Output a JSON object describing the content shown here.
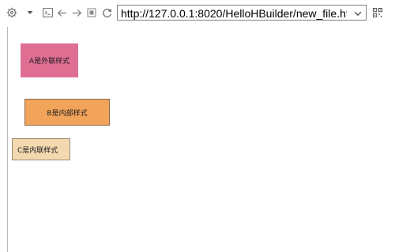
{
  "toolbar": {
    "icons": [
      "gear-icon",
      "chevron-down-icon",
      "terminal-icon",
      "back-arrow-icon",
      "forward-arrow-icon",
      "stop-icon",
      "refresh-icon",
      "dropdown-icon",
      "qr-code-icon"
    ],
    "address": {
      "url": "http://127.0.0.1:8020/HelloHBuilder/new_file.html"
    }
  },
  "page": {
    "box_a": {
      "label": "A是外联样式",
      "color": "#de6f93"
    },
    "box_b": {
      "label": "B是内部样式",
      "color": "#f2a45b"
    },
    "box_c": {
      "label": "C是内联样式",
      "color": "#f4d9b0"
    }
  }
}
